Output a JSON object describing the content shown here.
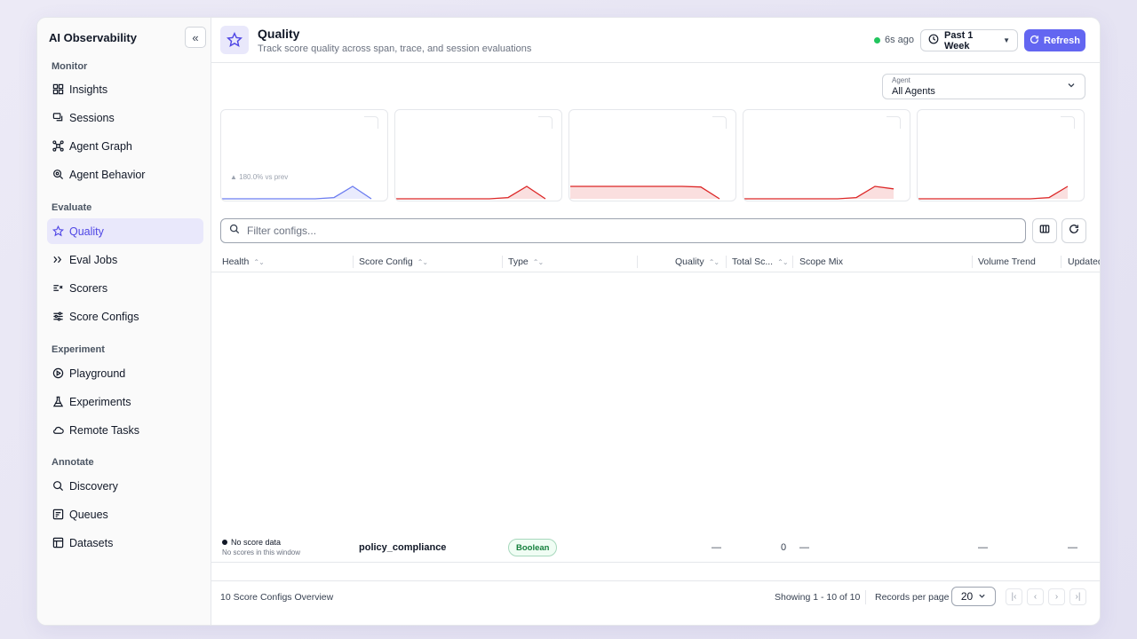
{
  "sidebar": {
    "title": "AI Observability",
    "sections": [
      {
        "label": "Monitor",
        "items": [
          {
            "label": "Insights",
            "icon": "grid-icon"
          },
          {
            "label": "Sessions",
            "icon": "chat-icon"
          },
          {
            "label": "Agent Graph",
            "icon": "graph-icon"
          },
          {
            "label": "Agent Behavior",
            "icon": "magnify-icon"
          }
        ]
      },
      {
        "label": "Evaluate",
        "items": [
          {
            "label": "Quality",
            "icon": "star-icon"
          },
          {
            "label": "Eval Jobs",
            "icon": "chevrons-icon"
          },
          {
            "label": "Scorers",
            "icon": "scorer-icon"
          },
          {
            "label": "Score Configs",
            "icon": "sliders-icon"
          }
        ]
      },
      {
        "label": "Experiment",
        "items": [
          {
            "label": "Playground",
            "icon": "play-icon"
          },
          {
            "label": "Experiments",
            "icon": "flask-icon"
          },
          {
            "label": "Remote Tasks",
            "icon": "cloud-icon"
          }
        ]
      },
      {
        "label": "Annotate",
        "items": [
          {
            "label": "Discovery",
            "icon": "search-icon"
          },
          {
            "label": "Queues",
            "icon": "queue-icon"
          },
          {
            "label": "Datasets",
            "icon": "table-icon"
          }
        ]
      }
    ],
    "active": "Quality"
  },
  "header": {
    "title": "Quality",
    "subtitle": "Track score quality across span, trace, and session evaluations",
    "status": "6s ago",
    "status_color": "#22c55e",
    "range_label": "Past 1 Week",
    "refresh_label": "Refresh",
    "accent": "#6366f1"
  },
  "agent_filter": {
    "label": "Agent",
    "value": "All Agents"
  },
  "cards": [
    {
      "delta": "▲ 180.0% vs prev",
      "color": "#6b7cf0",
      "trend": [
        0,
        0,
        0,
        0,
        0,
        0,
        0.1,
        1.0,
        0
      ]
    },
    {
      "delta": "",
      "color": "#dc2626",
      "trend": [
        0,
        0,
        0,
        0,
        0,
        0,
        0.1,
        1.0,
        0
      ]
    },
    {
      "delta": "",
      "color": "#dc2626",
      "trend": [
        1,
        1,
        1,
        1,
        1,
        1,
        1,
        0.95,
        0
      ]
    },
    {
      "delta": "",
      "color": "#dc2626",
      "trend": [
        0,
        0,
        0,
        0,
        0,
        0,
        0.1,
        1.0,
        0.8
      ]
    },
    {
      "delta": "",
      "color": "#dc2626",
      "trend": [
        0,
        0,
        0,
        0,
        0,
        0,
        0,
        0.1,
        1.0
      ]
    }
  ],
  "filter": {
    "placeholder": "Filter configs..."
  },
  "table": {
    "columns": [
      "Health",
      "Score Config",
      "Type",
      "Quality",
      "Total Sc...",
      "Scope Mix",
      "Volume Trend",
      "Updated"
    ],
    "rows": [
      {
        "health": "No score data",
        "health_sub": "No scores in this window",
        "score_config": "policy_compliance",
        "type": "Boolean",
        "quality": "—",
        "total_scores": "0",
        "scope_mix": "—",
        "volume_trend": "—",
        "updated": "—"
      }
    ]
  },
  "footer": {
    "summary": "10 Score Configs Overview",
    "showing": "Showing 1 - 10 of 10",
    "records_label": "Records per page",
    "page_size": "20"
  }
}
